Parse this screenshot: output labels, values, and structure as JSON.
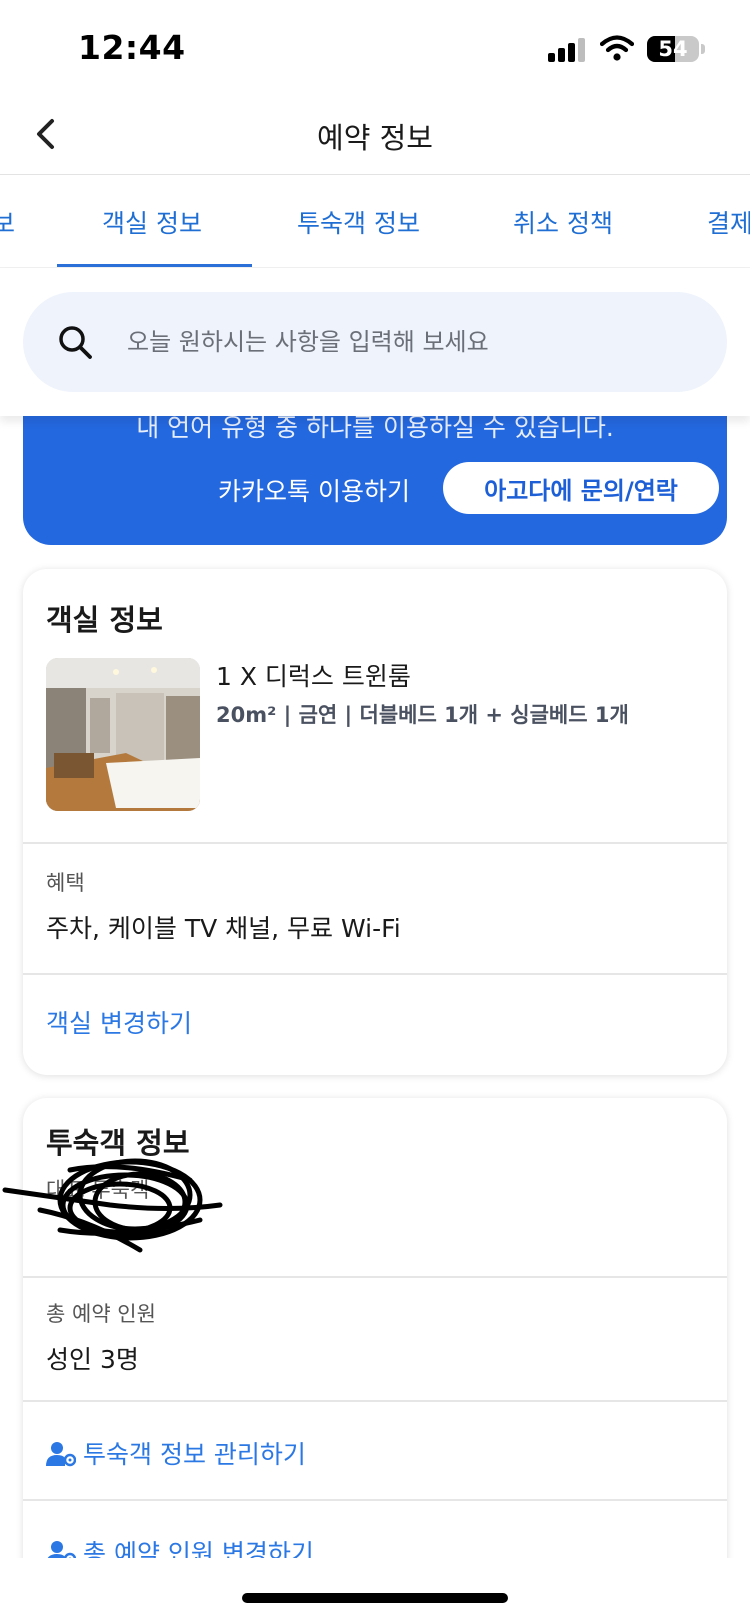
{
  "status_bar": {
    "time": "12:44",
    "battery": "54",
    "battery_level": 0.54
  },
  "header": {
    "title": "예약 정보"
  },
  "tabs": [
    {
      "label": "보"
    },
    {
      "label": "객실 정보"
    },
    {
      "label": "투숙객 정보"
    },
    {
      "label": "취소 정책"
    },
    {
      "label": "결제"
    }
  ],
  "search": {
    "placeholder": "오늘 원하시는 사항을 입력해 보세요"
  },
  "banner": {
    "cut_text": "내 언어 유형 중 하나를 이용하실 수 있습니다.",
    "kakao_label": "카카오톡 이용하기",
    "contact_label": "아고다에 문의/연락",
    "color": "#2468df"
  },
  "room_card": {
    "title": "객실 정보",
    "room_name": "1 X 디럭스 트윈룸",
    "room_detail": "20m² | 금연 | 더블베드 1개 + 싱글베드 1개",
    "benefit_label": "혜택",
    "benefits": "주차, 케이블 TV 채널, 무료 Wi-Fi",
    "change_link": "객실 변경하기"
  },
  "guest_card": {
    "title": "투숙객 정보",
    "lead_guest_label": "대표 투숙객",
    "total_label": "총 예약 인원",
    "total_value": "성인 3명",
    "manage_link": "투숙객 정보 관리하기",
    "change_count_link": "총 예약 인원 변경하기"
  },
  "colors": {
    "accent": "#2b78e4",
    "banner": "#2468df"
  },
  "icons": {
    "back": "chevron-left-icon",
    "search": "search-icon",
    "guest": "person-gear-icon"
  }
}
